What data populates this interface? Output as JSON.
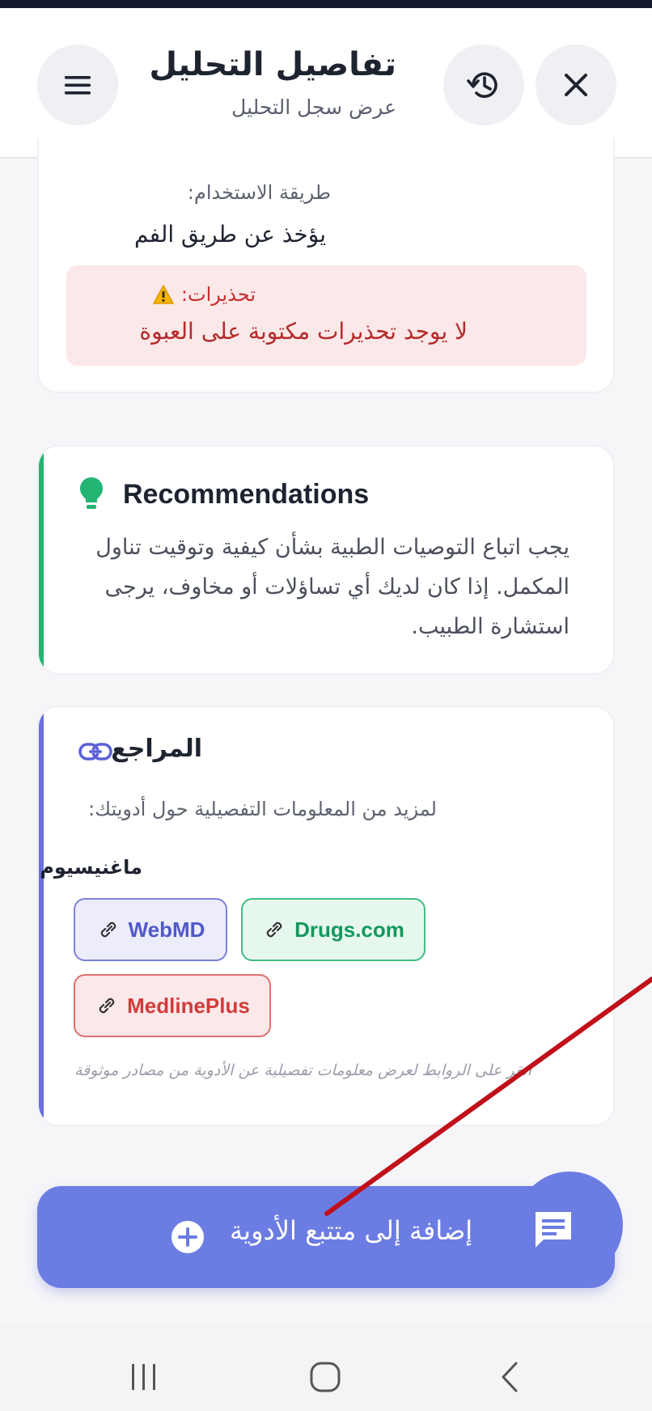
{
  "header": {
    "title": "تفاصيل التحليل",
    "subtitle": "عرض سجل التحليل",
    "menu_icon": "hamburger-menu-icon",
    "history_icon": "history-icon",
    "close_icon": "close-icon"
  },
  "usage": {
    "label": "طريقة الاستخدام:",
    "value": "يؤخذ عن طريق الفم"
  },
  "warnings": {
    "title": "تحذيرات:",
    "text": "لا يوجد تحذيرات مكتوبة على العبوة",
    "icon": "warning-triangle-icon"
  },
  "recommendations": {
    "title": "Recommendations",
    "text": "يجب اتباع التوصيات الطبية بشأن كيفية وتوقيت تناول المكمل. إذا كان لديك أي تساؤلات أو مخاوف، يرجى استشارة الطبيب.",
    "icon": "lightbulb-icon",
    "accent_color": "#22b573"
  },
  "references": {
    "title": "المراجع",
    "icon": "link-icon",
    "subtitle": "لمزيد من المعلومات التفصيلية حول أدويتك:",
    "drug_name": "ماغنيسيوم",
    "links": [
      {
        "label": "WebMD",
        "color": "#5058c8",
        "bg": "#ececfb",
        "border": "#7c82d8"
      },
      {
        "label": "Drugs.com",
        "color": "#12995c",
        "bg": "#e6f7ee",
        "border": "#3fbe82"
      },
      {
        "label": "MedlinePlus",
        "color": "#d23b3b",
        "bg": "#fbe8e8",
        "border": "#df6f6f"
      }
    ],
    "note": "انقر على الروابط لعرض معلومات تفصيلية عن الأدوية من مصادر موثوقة",
    "accent_color": "#6b6fe0"
  },
  "cta": {
    "label": "إضافة إلى متتبع الأدوية",
    "icon": "plus-circle-icon",
    "color": "#6b7ce3"
  },
  "fab": {
    "icon": "chat-message-icon"
  },
  "navbar": {
    "recents_icon": "recents-icon",
    "home_icon": "home-icon",
    "back_icon": "back-icon"
  },
  "annotation": {
    "color": "#c0101a"
  }
}
